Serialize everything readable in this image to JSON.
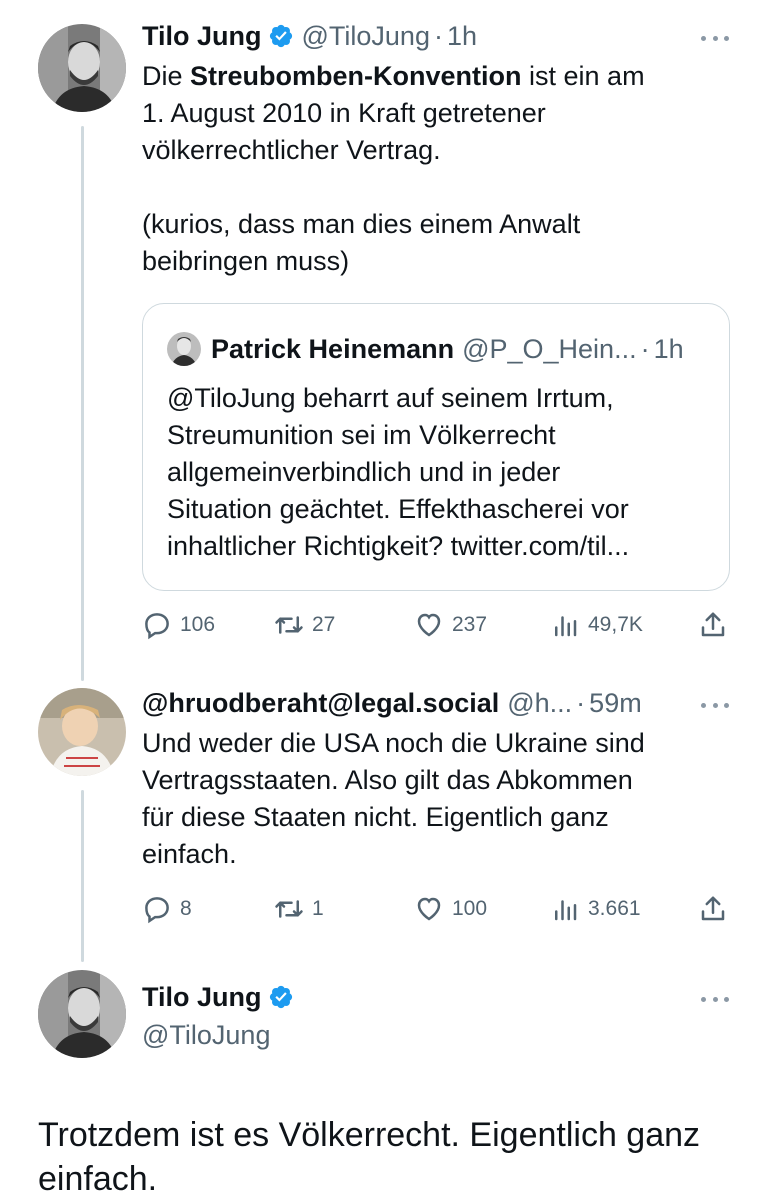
{
  "tweets": [
    {
      "author_name": "Tilo Jung",
      "handle": "@TiloJung",
      "dot": "·",
      "time": "1h",
      "text_prefix": "Die ",
      "text_bold": "Streubomben-Konvention",
      "text_line1_rest": " ist ein am",
      "text_line2": "1. August 2010 in Kraft getretener",
      "text_line3": "völkerrechtlicher Vertrag.",
      "text_line4": "(kurios, dass man dies einem Anwalt",
      "text_line5": "beibringen muss)",
      "quote": {
        "author_name": "Patrick Heinemann",
        "handle": "@P_O_Hein...",
        "dot": "·",
        "time": "1h",
        "lines": [
          "@TiloJung beharrt auf seinem Irrtum,",
          "Streumunition sei im Völkerrecht",
          "allgemeinverbindlich und in jeder",
          "Situation geächtet. Effekthascherei vor",
          "inhaltlicher Richtigkeit? twitter.com/til..."
        ]
      },
      "actions": {
        "replies": "106",
        "retweets": "27",
        "likes": "237",
        "views": "49,7K"
      }
    },
    {
      "author_name": "@hruodberaht@legal.social",
      "handle": "@h...",
      "dot": "·",
      "time": "59m",
      "lines": [
        "Und weder die USA noch die Ukraine sind",
        "Vertragsstaaten. Also gilt das Abkommen",
        "für diese Staaten nicht. Eigentlich ganz",
        "einfach."
      ],
      "actions": {
        "replies": "8",
        "retweets": "1",
        "likes": "100",
        "views": "3.661"
      }
    }
  ],
  "focus_tweet": {
    "author_name": "Tilo Jung",
    "handle": "@TiloJung",
    "line1": "Trotzdem ist es Völkerrecht. Eigentlich ganz",
    "line2": "einfach."
  },
  "colors": {
    "text": "#0f1419",
    "secondary": "#536471",
    "verified": "#1d9bf0",
    "border": "#cfd9de"
  },
  "icons": [
    "verified-badge-icon",
    "reply-icon",
    "retweet-icon",
    "like-icon",
    "views-icon",
    "share-icon",
    "more-icon"
  ]
}
